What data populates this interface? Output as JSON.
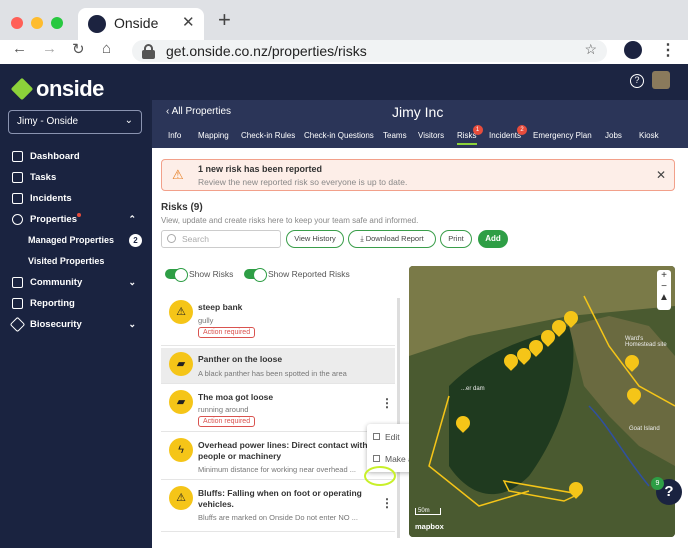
{
  "browser": {
    "tab_title": "Onside",
    "url": "get.onside.co.nz/properties/risks",
    "tab_close": "✕",
    "new_tab": "+"
  },
  "sidebar": {
    "brand": "onside",
    "org": "Jimy - Onside",
    "items": [
      {
        "label": "Dashboard"
      },
      {
        "label": "Tasks"
      },
      {
        "label": "Incidents"
      },
      {
        "label": "Properties"
      },
      {
        "label": "Managed Properties",
        "badge": "2"
      },
      {
        "label": "Visited Properties"
      },
      {
        "label": "Community"
      },
      {
        "label": "Reporting"
      },
      {
        "label": "Biosecurity"
      }
    ]
  },
  "header": {
    "back": "All Properties",
    "title": "Jimy Inc",
    "tabs": [
      {
        "label": "Info"
      },
      {
        "label": "Mapping"
      },
      {
        "label": "Check-in Rules"
      },
      {
        "label": "Check-in Questions"
      },
      {
        "label": "Teams"
      },
      {
        "label": "Visitors"
      },
      {
        "label": "Risks",
        "badge": "1"
      },
      {
        "label": "Incidents",
        "badge": "2"
      },
      {
        "label": "Emergency Plan"
      },
      {
        "label": "Jobs"
      },
      {
        "label": "Kiosk"
      }
    ]
  },
  "alert": {
    "title": "1 new risk has been reported",
    "subtitle": "Review the new reported risk so everyone is up to date."
  },
  "risks": {
    "title": "Risks (9)",
    "subtitle": "View, update and create risks here to keep your team safe and informed.",
    "search_placeholder": "Search",
    "buttons": {
      "view_history": "View History",
      "download_report": "Download Report",
      "print": "Print",
      "add": "Add"
    },
    "toggles": {
      "show_risks": "Show Risks",
      "show_reported": "Show Reported Risks"
    },
    "items": [
      {
        "name": "steep bank",
        "desc": "gully",
        "action": "Action required"
      },
      {
        "name": "Panther on the loose",
        "desc": "A black panther has been spotted in the area",
        "action": ""
      },
      {
        "name": "The moa got loose",
        "desc": "running around",
        "action": "Action required"
      },
      {
        "name": "Overhead power lines: Direct contact with people or machinery",
        "desc": "Minimum distance for working near overhead ...",
        "action": ""
      },
      {
        "name": "Bluffs: Falling when on foot or operating vehicles.",
        "desc": "Bluffs are marked on Onside Do not enter NO ...",
        "action": ""
      }
    ]
  },
  "context_menu": {
    "edit": "Edit",
    "copy": "Make a copy"
  },
  "map": {
    "scale": "50m",
    "logo": "mapbox",
    "labels": [
      "Ward's Homestead site",
      "Goat Island",
      "...er dam"
    ],
    "zoom_in": "+",
    "zoom_out": "−"
  },
  "help": {
    "label": "?",
    "badge": "9"
  },
  "colors": {
    "sidebar_bg": "#1a2340",
    "accent_green": "#2e9e45",
    "brand_green": "#8cd23a",
    "risk_yellow": "#f5c518",
    "alert_red": "#e74c3c"
  }
}
